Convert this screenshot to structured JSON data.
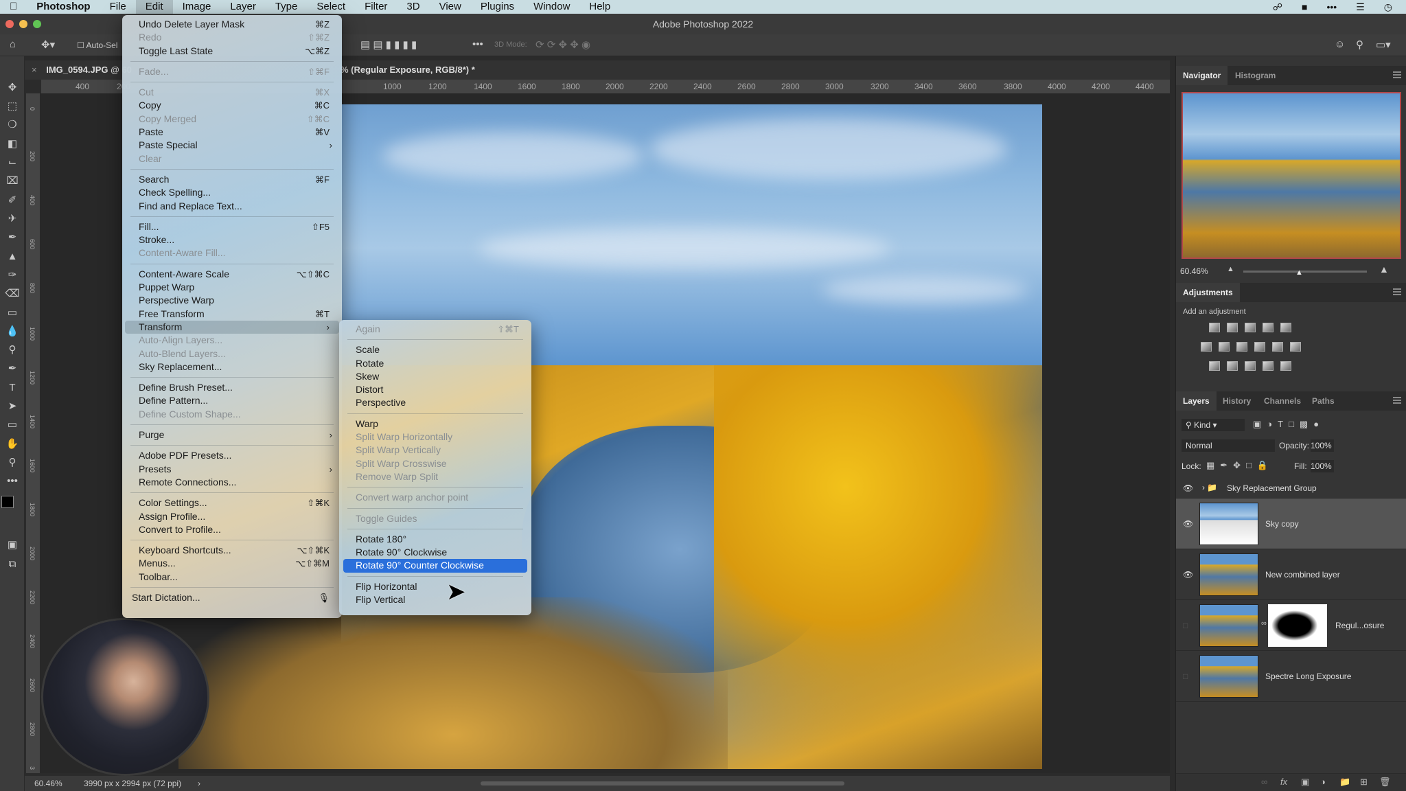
{
  "mac_menubar": {
    "apple_icon": "apple-icon",
    "app_name": "Photoshop",
    "items": [
      "File",
      "Edit",
      "Image",
      "Layer",
      "Type",
      "Select",
      "Filter",
      "3D",
      "View",
      "Plugins",
      "Window",
      "Help"
    ],
    "active": "Edit",
    "status_icons": [
      "creative-cloud-icon",
      "screen-record-icon",
      "more-icon",
      "control-center-icon",
      "clock-icon"
    ]
  },
  "window": {
    "title": "Adobe Photoshop 2022"
  },
  "options_bar": {
    "auto_select_label": "Auto-Sel",
    "mode_3d_label": "3D Mode:"
  },
  "document": {
    "tab_title": "IMG_0594.JPG @ 60.46% (Regular Exposure, RGB/8*) *",
    "tab_title_left": "IMG_0594.JPG @ 60",
    "tab_title_right": "% (Regular Exposure, RGB/8*) *",
    "ruler_ticks": [
      "400",
      "200",
      "1000",
      "1200",
      "1400",
      "1600",
      "1800",
      "2000",
      "2200",
      "2400",
      "2600",
      "2800",
      "3000",
      "3200",
      "3400",
      "3600",
      "3800",
      "4000",
      "4200",
      "4400"
    ],
    "vertical_ruler_ticks": [
      "0",
      "200",
      "400",
      "600",
      "800",
      "1000",
      "1200",
      "1400",
      "1600",
      "1800",
      "2000",
      "2200",
      "2400",
      "2600",
      "2800",
      "3"
    ]
  },
  "status_bar": {
    "zoom": "60.46%",
    "doc_info": "3990 px x 2994 px (72 ppi)"
  },
  "edit_menu": {
    "groups": [
      [
        {
          "label": "Undo Delete Layer Mask",
          "shortcut": "⌘Z"
        },
        {
          "label": "Redo",
          "shortcut": "⇧⌘Z",
          "disabled": true
        },
        {
          "label": "Toggle Last State",
          "shortcut": "⌥⌘Z"
        }
      ],
      [
        {
          "label": "Fade...",
          "shortcut": "⇧⌘F",
          "disabled": true
        }
      ],
      [
        {
          "label": "Cut",
          "shortcut": "⌘X",
          "disabled": true
        },
        {
          "label": "Copy",
          "shortcut": "⌘C"
        },
        {
          "label": "Copy Merged",
          "shortcut": "⇧⌘C",
          "disabled": true
        },
        {
          "label": "Paste",
          "shortcut": "⌘V"
        },
        {
          "label": "Paste Special",
          "submenu": true
        },
        {
          "label": "Clear",
          "disabled": true
        }
      ],
      [
        {
          "label": "Search",
          "shortcut": "⌘F"
        },
        {
          "label": "Check Spelling..."
        },
        {
          "label": "Find and Replace Text..."
        }
      ],
      [
        {
          "label": "Fill...",
          "shortcut": "⇧F5"
        },
        {
          "label": "Stroke..."
        },
        {
          "label": "Content-Aware Fill...",
          "disabled": true
        }
      ],
      [
        {
          "label": "Content-Aware Scale",
          "shortcut": "⌥⇧⌘C"
        },
        {
          "label": "Puppet Warp"
        },
        {
          "label": "Perspective Warp"
        },
        {
          "label": "Free Transform",
          "shortcut": "⌘T"
        },
        {
          "label": "Transform",
          "submenu": true,
          "selected": true
        },
        {
          "label": "Auto-Align Layers...",
          "disabled": true
        },
        {
          "label": "Auto-Blend Layers...",
          "disabled": true
        },
        {
          "label": "Sky Replacement..."
        }
      ],
      [
        {
          "label": "Define Brush Preset..."
        },
        {
          "label": "Define Pattern..."
        },
        {
          "label": "Define Custom Shape...",
          "disabled": true
        }
      ],
      [
        {
          "label": "Purge",
          "submenu": true
        }
      ],
      [
        {
          "label": "Adobe PDF Presets..."
        },
        {
          "label": "Presets",
          "submenu": true
        },
        {
          "label": "Remote Connections..."
        }
      ],
      [
        {
          "label": "Color Settings...",
          "shortcut": "⇧⌘K"
        },
        {
          "label": "Assign Profile..."
        },
        {
          "label": "Convert to Profile..."
        }
      ],
      [
        {
          "label": "Keyboard Shortcuts...",
          "shortcut": "⌥⇧⌘K"
        },
        {
          "label": "Menus...",
          "shortcut": "⌥⇧⌘M"
        },
        {
          "label": "Toolbar..."
        }
      ],
      [
        {
          "label": "Start Dictation...",
          "shortcut": "🎙",
          "outdent": true
        }
      ]
    ]
  },
  "transform_submenu": {
    "groups": [
      [
        {
          "label": "Again",
          "shortcut": "⇧⌘T",
          "disabled": true
        }
      ],
      [
        {
          "label": "Scale"
        },
        {
          "label": "Rotate"
        },
        {
          "label": "Skew"
        },
        {
          "label": "Distort"
        },
        {
          "label": "Perspective"
        }
      ],
      [
        {
          "label": "Warp"
        },
        {
          "label": "Split Warp Horizontally",
          "disabled": true
        },
        {
          "label": "Split Warp Vertically",
          "disabled": true
        },
        {
          "label": "Split Warp Crosswise",
          "disabled": true
        },
        {
          "label": "Remove Warp Split",
          "disabled": true
        }
      ],
      [
        {
          "label": "Convert warp anchor point",
          "disabled": true
        }
      ],
      [
        {
          "label": "Toggle Guides",
          "disabled": true
        }
      ],
      [
        {
          "label": "Rotate 180°"
        },
        {
          "label": "Rotate 90° Clockwise"
        },
        {
          "label": "Rotate 90° Counter Clockwise",
          "highlighted": true
        }
      ],
      [
        {
          "label": "Flip Horizontal"
        },
        {
          "label": "Flip Vertical"
        }
      ]
    ]
  },
  "navigator": {
    "tabs": [
      "Navigator",
      "Histogram"
    ],
    "active_tab": "Navigator",
    "zoom": "60.46%",
    "zoom_slider_fraction": 0.45
  },
  "adjustments": {
    "tab": "Adjustments",
    "hint": "Add an adjustment",
    "rows": [
      [
        "brightness-contrast-icon",
        "levels-icon",
        "curves-icon",
        "exposure-icon",
        "vibrance-icon"
      ],
      [
        "hue-saturation-icon",
        "color-balance-icon",
        "black-white-icon",
        "photo-filter-icon",
        "channel-mixer-icon",
        "color-lookup-icon"
      ],
      [
        "invert-icon",
        "posterize-icon",
        "threshold-icon",
        "selective-color-icon",
        "gradient-map-icon"
      ]
    ]
  },
  "layers_panel": {
    "tabs": [
      "Layers",
      "History",
      "Channels",
      "Paths"
    ],
    "active_tab": "Layers",
    "filter_label": "Kind",
    "blend_mode": "Normal",
    "opacity_label": "Opacity:",
    "opacity": "100%",
    "lock_label": "Lock:",
    "fill_label": "Fill:",
    "fill": "100%",
    "layers": [
      {
        "name": "Sky Replacement Group",
        "type": "group",
        "visible": true
      },
      {
        "name": "Sky copy",
        "visible": true,
        "selected": true
      },
      {
        "name": "New combined layer",
        "visible": true
      },
      {
        "name": "Regul...osure",
        "visible": false,
        "has_mask": true
      },
      {
        "name": "Spectre Long Exposure",
        "visible": false
      }
    ],
    "footer_icons": [
      "link-layers-icon",
      "fx-icon",
      "add-mask-icon",
      "adjustment-layer-icon",
      "new-group-icon",
      "new-layer-icon",
      "trash-icon"
    ]
  }
}
